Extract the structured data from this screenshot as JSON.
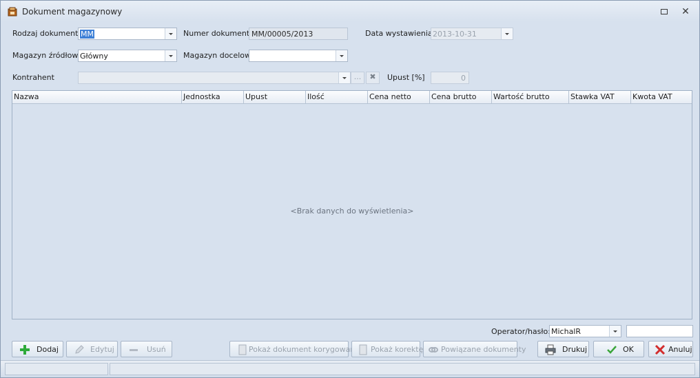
{
  "window": {
    "title": "Dokument magazynowy",
    "restore_icon": "restore-icon",
    "close_icon": "close-icon",
    "close_glyph": "✕"
  },
  "form": {
    "doc_type": {
      "label": "Rodzaj dokumentu",
      "value": "MM"
    },
    "doc_number": {
      "label": "Numer dokumentu",
      "value": "MM/00005/2013"
    },
    "issue_date": {
      "label": "Data wystawienia",
      "value": "2013-10-31"
    },
    "source_warehouse": {
      "label": "Magazyn źródłowy",
      "value": "Główny"
    },
    "target_warehouse": {
      "label": "Magazyn docelowy",
      "value": ""
    },
    "contractor": {
      "label": "Kontrahent",
      "value": "",
      "browse_label": "...",
      "clear_glyph": "✖"
    },
    "discount": {
      "label": "Upust [%]",
      "value": "0"
    }
  },
  "grid": {
    "columns": [
      "Nazwa",
      "Jednostka",
      "Upust",
      "Ilość",
      "Cena netto",
      "Cena brutto",
      "Wartość brutto",
      "Stawka VAT",
      "Kwota VAT"
    ],
    "empty_message": "<Brak danych do wyświetlenia>"
  },
  "operator": {
    "label": "Operator/hasło:",
    "value": "MichalR",
    "password": ""
  },
  "buttons": {
    "add": "Dodaj",
    "edit": "Edytuj",
    "delete": "Usuń",
    "show_corrected": "Pokaż dokument korygowany",
    "show_correction": "Pokaż korektę",
    "related_docs": "Powiązane dokumenty",
    "print": "Drukuj",
    "ok": "OK",
    "cancel": "Anuluj"
  },
  "colors": {
    "accent": "#3d7fd6",
    "add_green": "#2eaa3a",
    "ok_green": "#3aa53a",
    "cancel_red": "#d22d2d"
  }
}
